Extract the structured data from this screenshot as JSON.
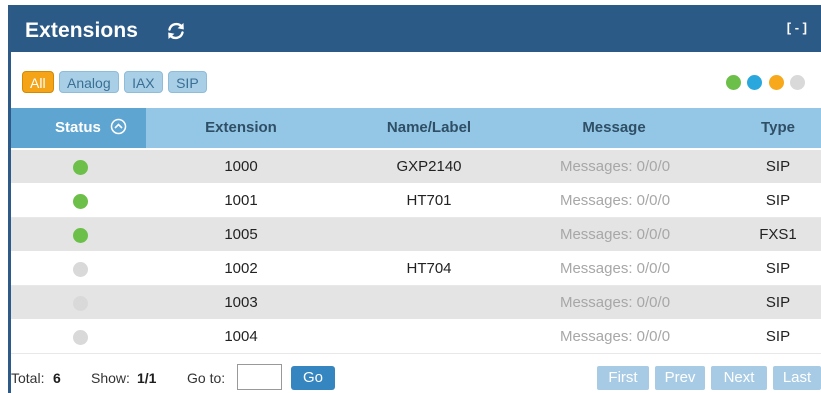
{
  "header": {
    "title": "Extensions",
    "collapse_label": "[ - ]"
  },
  "filters": [
    {
      "label": "All",
      "active": true
    },
    {
      "label": "Analog",
      "active": false
    },
    {
      "label": "IAX",
      "active": false
    },
    {
      "label": "SIP",
      "active": false
    }
  ],
  "legend_colors": [
    "#6cc04a",
    "#2aa8de",
    "#f7a81b",
    "#d9d9d9"
  ],
  "columns": {
    "status": "Status",
    "extension": "Extension",
    "name": "Name/Label",
    "message": "Message",
    "type": "Type"
  },
  "rows": [
    {
      "status_color": "#6cc04a",
      "extension": "1000",
      "name": "GXP2140",
      "message_label": "Messages:",
      "message_value": "0/0/0",
      "type": "SIP"
    },
    {
      "status_color": "#6cc04a",
      "extension": "1001",
      "name": "HT701",
      "message_label": "Messages:",
      "message_value": "0/0/0",
      "type": "SIP"
    },
    {
      "status_color": "#6cc04a",
      "extension": "1005",
      "name": "",
      "message_label": "Messages:",
      "message_value": "0/0/0",
      "type": "FXS1"
    },
    {
      "status_color": "#d9d9d9",
      "extension": "1002",
      "name": "HT704",
      "message_label": "Messages:",
      "message_value": "0/0/0",
      "type": "SIP"
    },
    {
      "status_color": "#d9d9d9",
      "extension": "1003",
      "name": "",
      "message_label": "Messages:",
      "message_value": "0/0/0",
      "type": "SIP"
    },
    {
      "status_color": "#d9d9d9",
      "extension": "1004",
      "name": "",
      "message_label": "Messages:",
      "message_value": "0/0/0",
      "type": "SIP"
    }
  ],
  "footer": {
    "total_label": "Total:",
    "total_value": "6",
    "show_label": "Show:",
    "show_value": "1/1",
    "goto_label": "Go to:",
    "goto_value": "",
    "go_label": "Go",
    "pager": {
      "first": "First",
      "prev": "Prev",
      "next": "Next",
      "last": "Last"
    }
  }
}
